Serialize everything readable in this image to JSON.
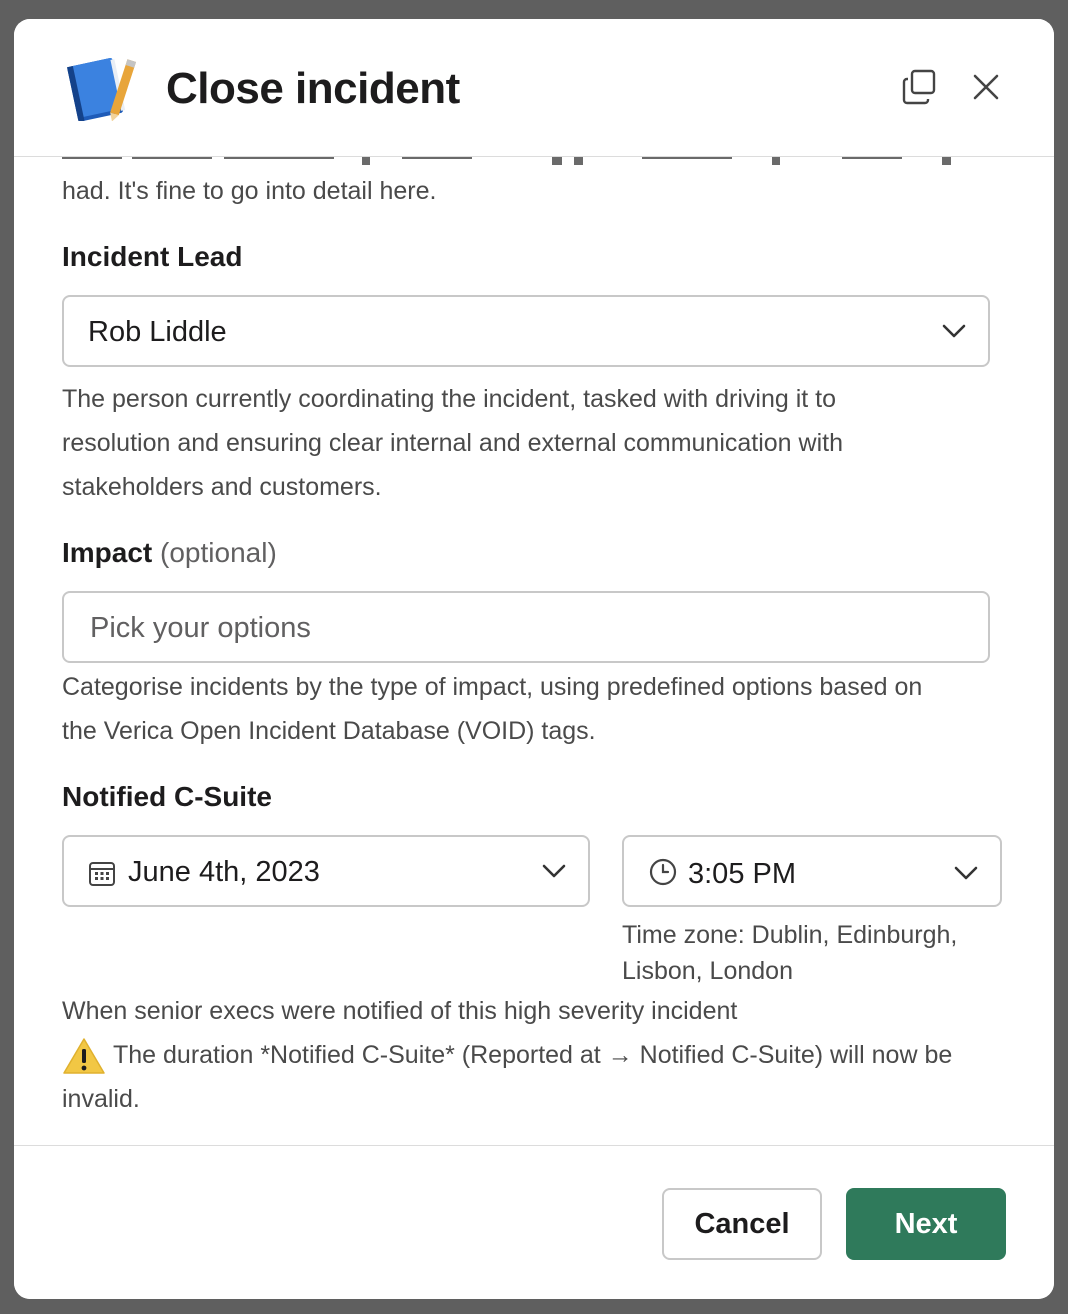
{
  "header": {
    "title": "Close incident",
    "icons": {
      "app": "notebook-icon",
      "copy": "copy-icon",
      "close": "close-icon"
    }
  },
  "summary": {
    "help_tail": "had. It's fine to go into detail here."
  },
  "incident_lead": {
    "label": "Incident Lead",
    "value": "Rob Liddle",
    "help_line1": "The person currently coordinating the incident, tasked with driving it to",
    "help_line2": "resolution and ensuring clear internal and external communication with",
    "help_line3": "stakeholders and customers."
  },
  "impact": {
    "label": "Impact",
    "optional": "(optional)",
    "placeholder": "Pick your options",
    "help_line1": "Categorise incidents by the type of impact, using predefined options based on",
    "help_line2": "the Verica Open Incident Database (VOID) tags."
  },
  "c_suite": {
    "label": "Notified C-Suite",
    "date": "June 4th, 2023",
    "time": "3:05 PM",
    "timezone_line1": "Time zone: Dublin, Edinburgh,",
    "timezone_line2": "Lisbon, London",
    "help": "When senior execs were notified of this high severity incident",
    "warning_line1": "The duration *Notified C-Suite* (Reported at → Notified C-Suite) will now be",
    "warning_line2": "invalid."
  },
  "footer": {
    "cancel_label": "Cancel",
    "next_label": "Next"
  },
  "colors": {
    "primary_button": "#2f7a5b",
    "warning": "#f2c744"
  }
}
